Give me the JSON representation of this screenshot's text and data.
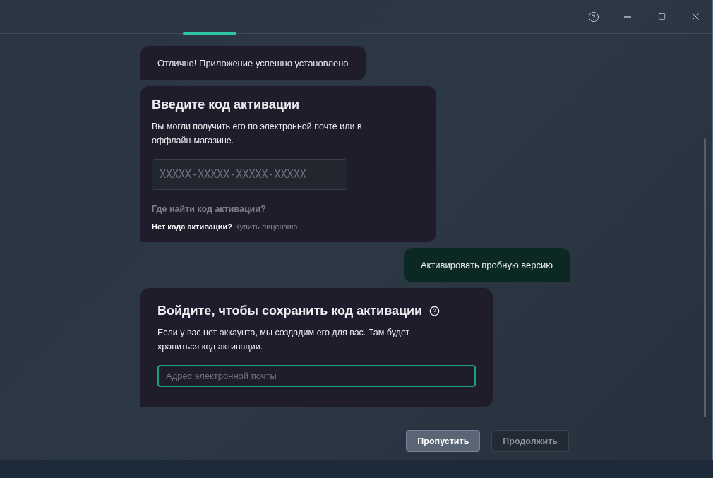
{
  "messages": [
    {
      "kind": "bot",
      "text": "Отлично! Приложение успешно установлено"
    },
    {
      "kind": "code_card",
      "title": "Введите код активации",
      "description": "Вы могли получить его по электронной почте или в оффлайн-магазине.",
      "code_placeholder": "XXXXX-XXXXX-XXXXX-XXXXX",
      "help_link": "Где найти код активации?",
      "no_code_text": "Нет кода активации?",
      "buy_link": "Купить лицензию"
    },
    {
      "kind": "user",
      "text": "Активировать пробную версию"
    },
    {
      "kind": "login_card",
      "title": "Войдите, чтобы сохранить код активации",
      "description": "Если у вас нет аккаунта, мы создадим его для вас. Там будет храниться код активации.",
      "email_placeholder": "Адрес электронной почты",
      "focused": true
    }
  ],
  "footer_buttons": [
    {
      "label": "Пропустить",
      "disabled": false
    },
    {
      "label": "Продолжить",
      "disabled": true
    }
  ]
}
